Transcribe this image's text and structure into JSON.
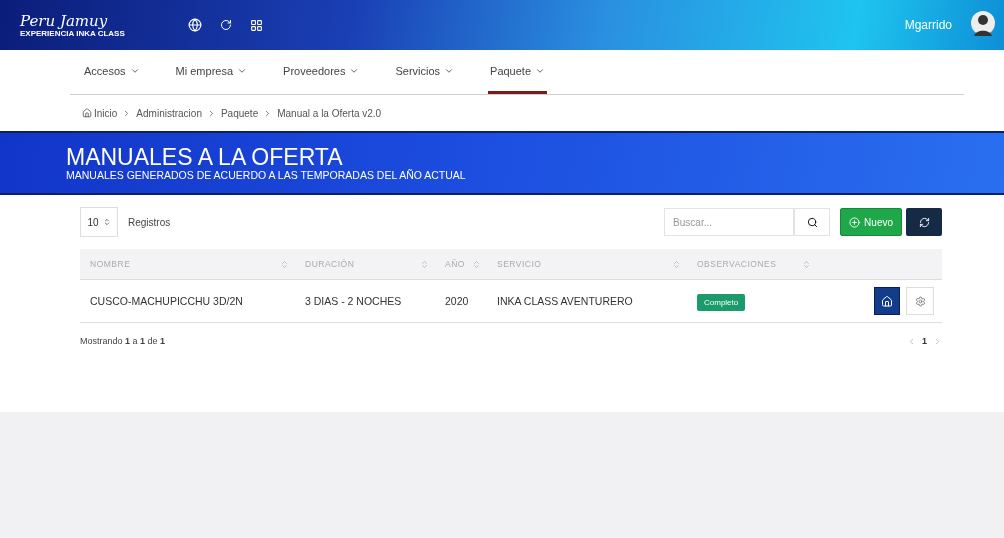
{
  "header": {
    "logo_title": "Peru Jamuy",
    "logo_subtitle": "EXPERIENCIA INKA CLASS",
    "user": "Mgarrido"
  },
  "nav": [
    {
      "label": "Accesos",
      "selected": false
    },
    {
      "label": "Mi empresa",
      "selected": false
    },
    {
      "label": "Proveedores",
      "selected": false
    },
    {
      "label": "Servicios",
      "selected": false
    },
    {
      "label": "Paquete",
      "selected": true
    }
  ],
  "breadcrumb": [
    "Inicio",
    "Administracion",
    "Paquete",
    "Manual a la Oferta v2.0"
  ],
  "banner": {
    "title": "MANUALES A LA OFERTA",
    "subtitle": "MANUALES GENERADOS DE ACUERDO A LAS TEMPORADAS DEL AÑO ACTUAL"
  },
  "toolbar": {
    "page_size": "10",
    "page_size_label": "Registros",
    "search_placeholder": "Buscar...",
    "new_button": "Nuevo"
  },
  "table": {
    "columns": [
      "NOMBRE",
      "DURACIÓN",
      "AÑO",
      "SERVICIO",
      "OBSERVACIONES"
    ],
    "rows": [
      {
        "cells": [
          "CUSCO-MACHUPICCHU 3D/2N",
          "3 DIAS - 2 NOCHES",
          "2020",
          "INKA CLASS AVENTURERO"
        ],
        "status": "Completo"
      }
    ]
  },
  "footer": {
    "info": "Mostrando **1** a **1** de **1**",
    "pages": [
      {
        "label": "1",
        "selected": true
      }
    ]
  }
}
